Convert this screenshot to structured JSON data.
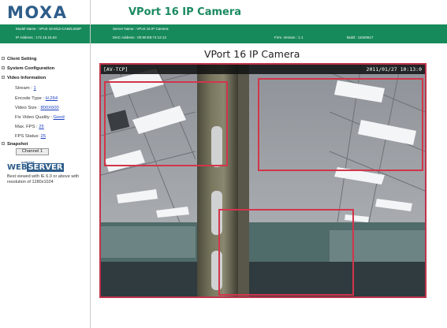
{
  "header": {
    "logo": "MOXA",
    "title": "VPort 16 IP Camera"
  },
  "infobar": {
    "model_name": "Model Name : VPort 16-M12-CAM/LS60P",
    "ip_address": "IP Address : 172.16.16.63",
    "server_name": "Server Name : VPort 16 IP Camera",
    "mac_address": "MAC Address : 00:90:E8:74:12:12",
    "firm_version": "Firm. Version : 1.1",
    "build": "Build : 11020617"
  },
  "sidebar": {
    "client_setting": "Client Setting",
    "system_configuration": "System Configuration",
    "video_information": "Video Information",
    "stream_label": "Stream : ",
    "stream_value": "1",
    "encode_label": "Encode Type : ",
    "encode_value": "H.264",
    "size_label": "Video Size : ",
    "size_value": "800X600",
    "quality_label": "Fix Video Quality : ",
    "quality_value": "Good",
    "maxfps_label": "Max. FPS : ",
    "maxfps_value": "25",
    "fpsstatus_label": "FPS Status: ",
    "fpsstatus_value": "25",
    "snapshot": "Snapshot",
    "channel_button": "Channel 1",
    "ws_small": "goahead",
    "ws_web": "WEB",
    "ws_server": "SERVER",
    "best_view": "Best viewed with IE 6.0 or above with resolution of 1280x1024"
  },
  "main": {
    "camera_heading": "VPort 16 IP Camera",
    "osd_left": "[AV-TCP]",
    "osd_right": "2011/01/27 10:13:0"
  },
  "colors": {
    "brand_blue": "#2e5d8a",
    "infobar_green": "#178a5c",
    "title_green": "#1a8a60",
    "motion_box_red": "#d2354a",
    "link_blue": "#1a3fbf"
  },
  "icons": {
    "nav_bullet": "square-bullet-icon"
  }
}
